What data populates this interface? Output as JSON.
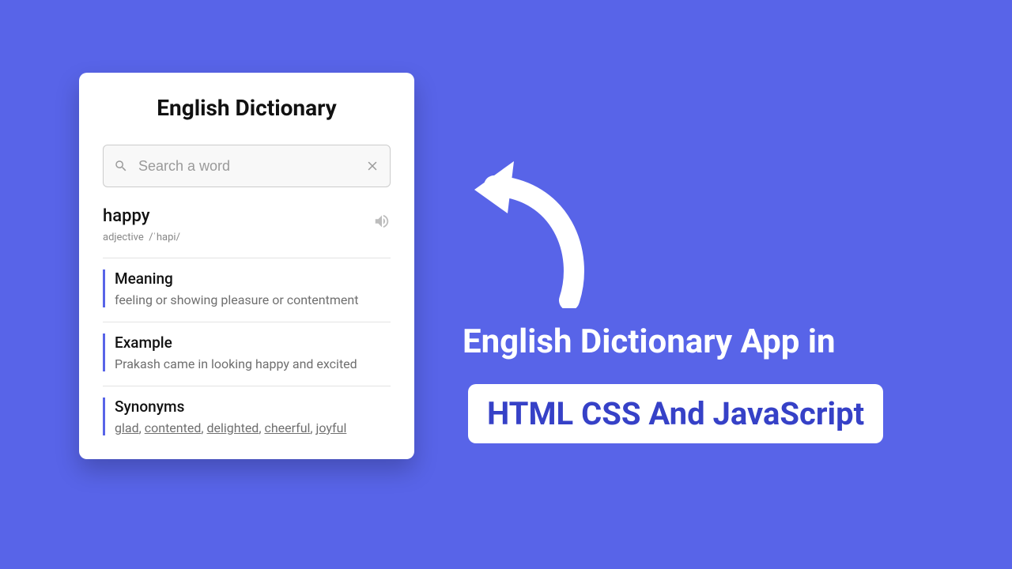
{
  "card": {
    "title": "English Dictionary",
    "search_placeholder": "Search a word",
    "word": "happy",
    "pos": "adjective",
    "phonetic": "/ˈhapi/",
    "meaning_label": "Meaning",
    "meaning_text": "feeling or showing pleasure or contentment",
    "example_label": "Example",
    "example_text": "Prakash came in looking happy and excited",
    "synonyms_label": "Synonyms",
    "synonyms": [
      "glad",
      "contented",
      "delighted",
      "cheerful",
      "joyful"
    ]
  },
  "headline": "English Dictionary App in",
  "pill": "HTML CSS And JavaScript"
}
